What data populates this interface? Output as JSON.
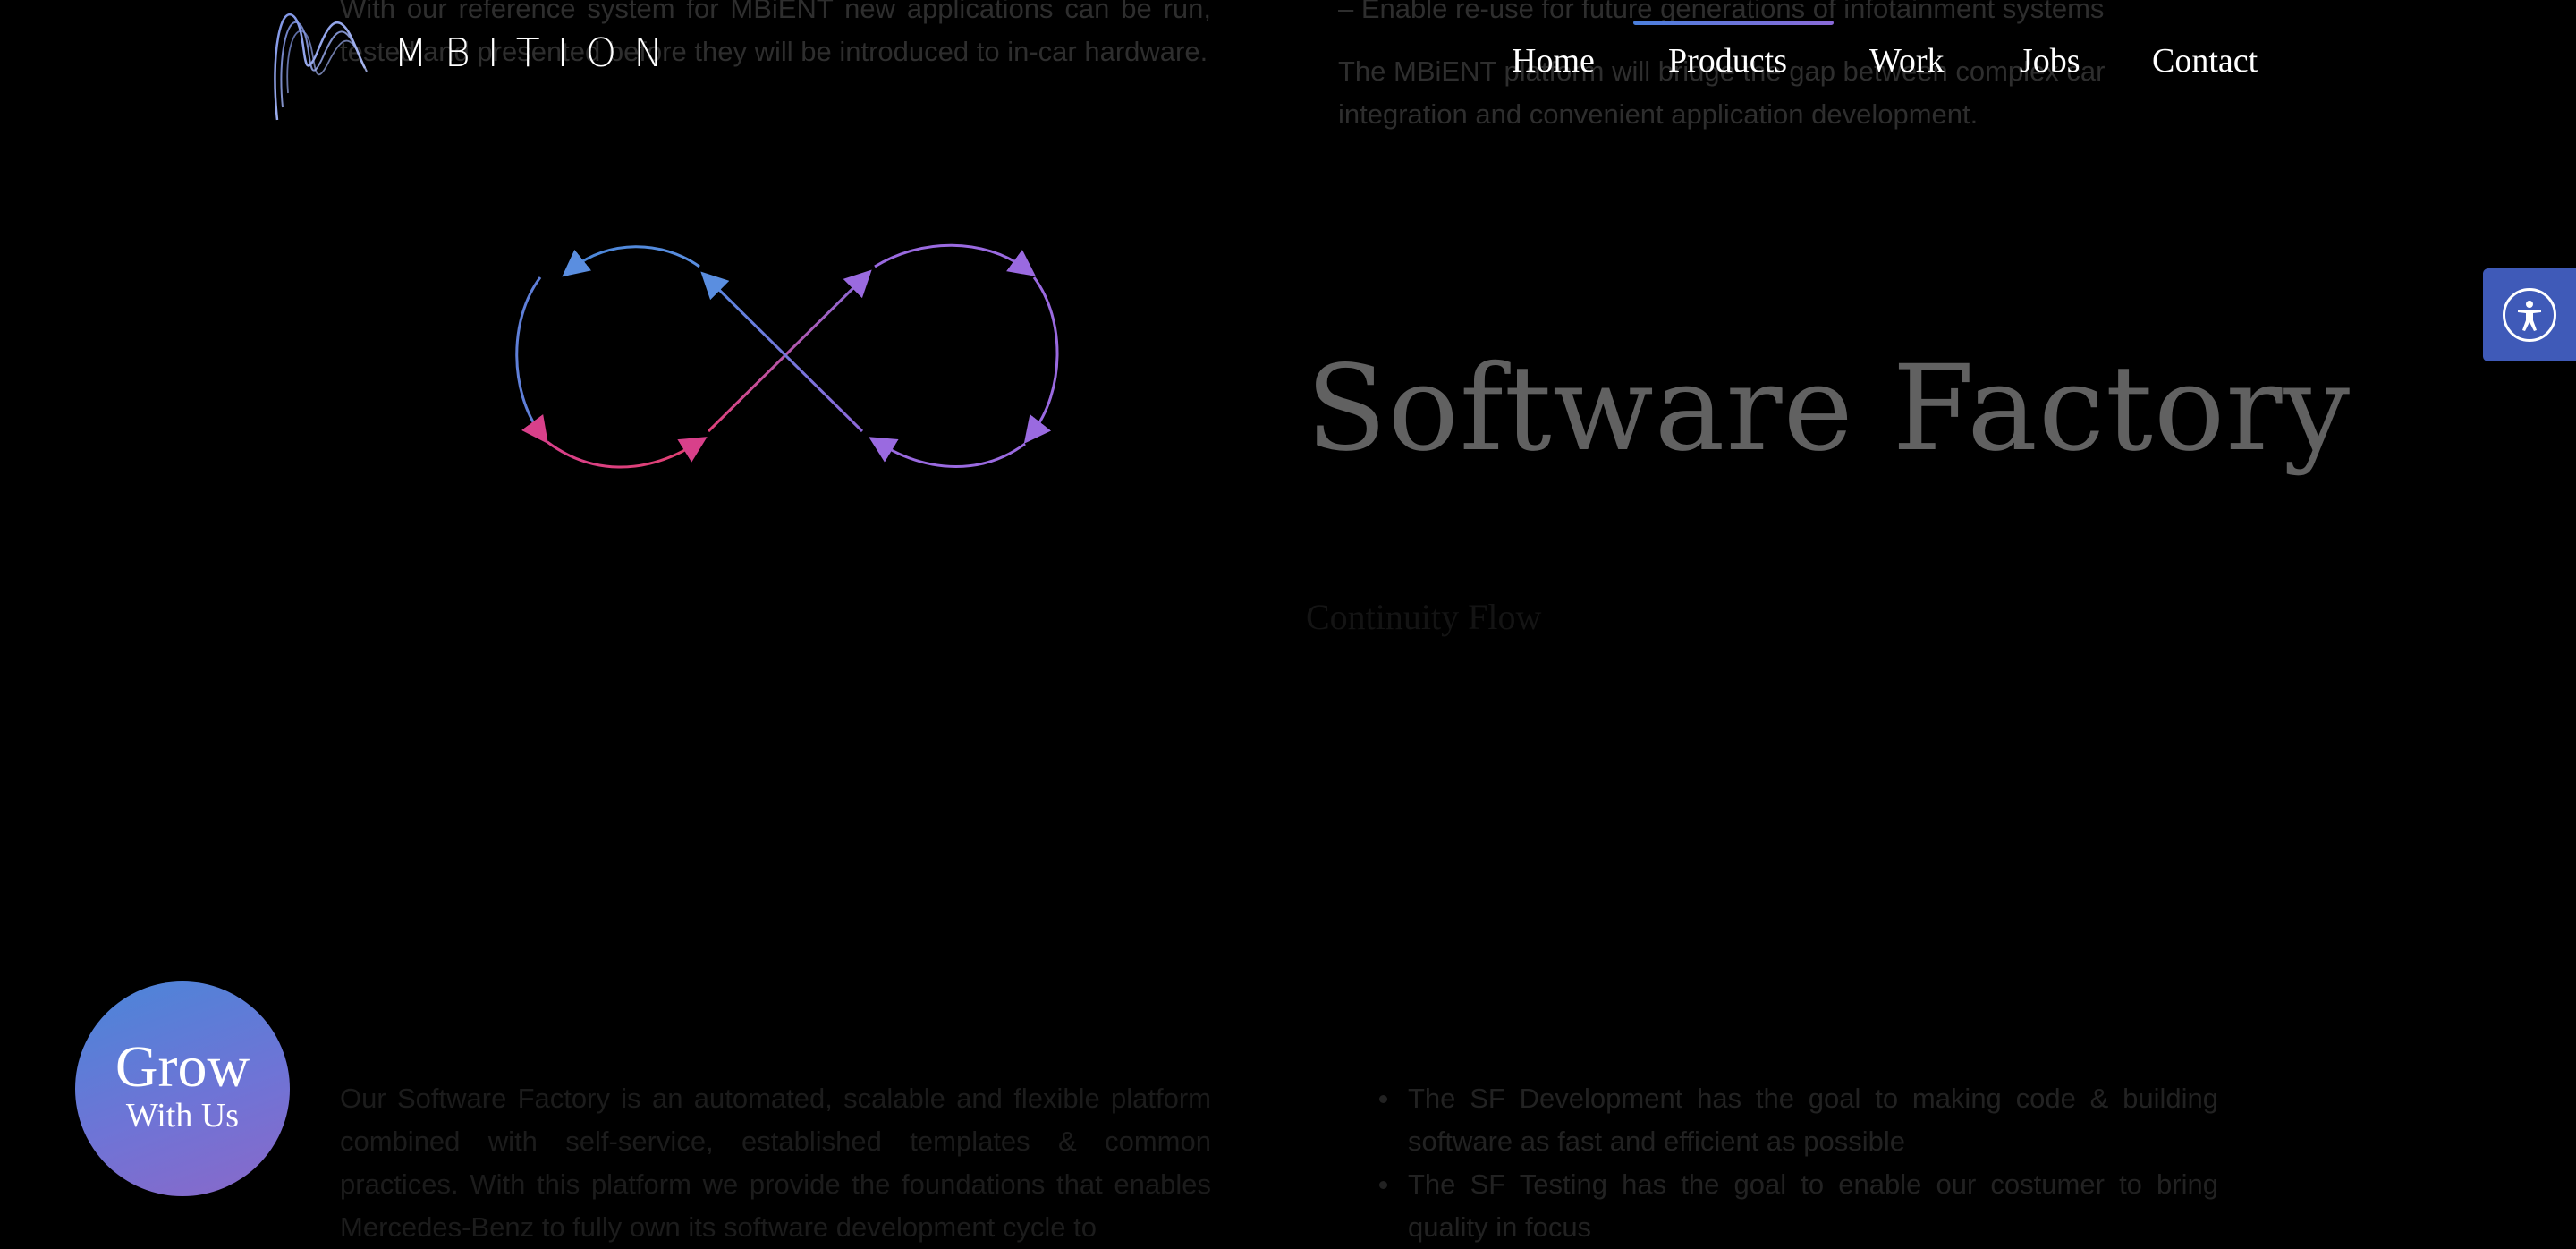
{
  "brand": {
    "logo_text": "MBITION"
  },
  "nav": {
    "items": [
      {
        "label": "Home"
      },
      {
        "label": "Products"
      },
      {
        "label": "Work"
      },
      {
        "label": "Jobs"
      },
      {
        "label": "Contact"
      }
    ],
    "active_index": 1
  },
  "background": {
    "left_top_paragraph": "With our reference system for MBiENT new applications can be run, tested and presented before they will be introduced to in-car hardware.",
    "right_top_item": "– Enable re-use for future generations of infotainment systems",
    "right_top_paragraph": "The MBiENT platform will bridge the gap between complex car integration and convenient application development.",
    "left_bottom_paragraph": "Our Software Factory is an automated, scalable and flexible platform combined with self-service, established templates & common practices. With this platform we provide the foundations that enables Mercedes-Benz to fully own its software development cycle to",
    "right_bottom_bullets": [
      "The SF Development has the goal to making code & building software as fast and efficient as possible",
      "The SF Testing has the goal to enable our costumer to bring quality in focus"
    ]
  },
  "section": {
    "title": "Software Factory",
    "subtitle": "Continuity Flow"
  },
  "grow_button": {
    "line1": "Grow",
    "line2": "With Us"
  },
  "colors": {
    "background": "#000000",
    "accent_blue": "#4a86d8",
    "accent_purple": "#8a68c9",
    "accent_pink": "#e0407a",
    "accessibility_blue": "#3f5ab8"
  },
  "icons": {
    "logo": "mbition-wave-logo",
    "accessibility": "accessibility-person-icon",
    "infinity": "infinity-loop-graphic"
  }
}
